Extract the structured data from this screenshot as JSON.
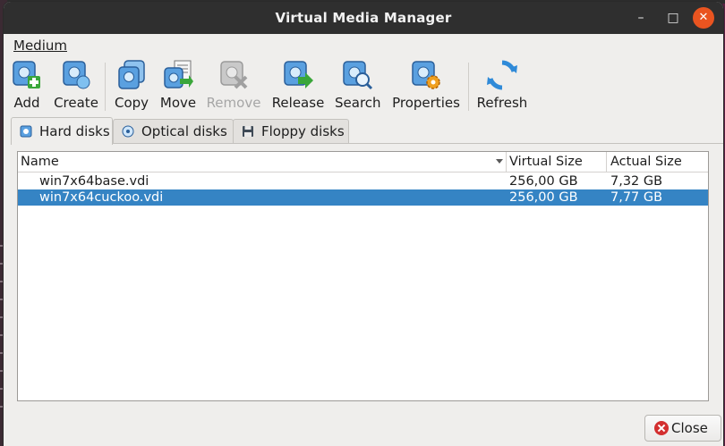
{
  "window": {
    "title": "Virtual Media Manager"
  },
  "menubar": {
    "medium": "Medium"
  },
  "toolbar": [
    {
      "label": "Add",
      "enabled": true,
      "icon": "disk-add-icon"
    },
    {
      "label": "Create",
      "enabled": true,
      "icon": "disk-create-icon"
    },
    {
      "label": "Copy",
      "enabled": true,
      "icon": "disk-copy-icon"
    },
    {
      "label": "Move",
      "enabled": true,
      "icon": "disk-move-icon"
    },
    {
      "label": "Remove",
      "enabled": false,
      "icon": "disk-remove-icon"
    },
    {
      "label": "Release",
      "enabled": true,
      "icon": "disk-release-icon"
    },
    {
      "label": "Search",
      "enabled": true,
      "icon": "disk-search-icon"
    },
    {
      "label": "Properties",
      "enabled": true,
      "icon": "disk-properties-icon"
    },
    {
      "label": "Refresh",
      "enabled": true,
      "icon": "refresh-icon"
    }
  ],
  "tabs": [
    {
      "label": "Hard disks",
      "active": true,
      "icon": "hard-disk-icon"
    },
    {
      "label": "Optical disks",
      "active": false,
      "icon": "optical-disk-icon"
    },
    {
      "label": "Floppy disks",
      "active": false,
      "icon": "floppy-disk-icon"
    }
  ],
  "table": {
    "columns": [
      "Name",
      "Virtual Size",
      "Actual Size"
    ],
    "sort_column": "Name",
    "rows": [
      {
        "name": "win7x64base.vdi",
        "virtual_size": "256,00 GB",
        "actual_size": "7,32 GB",
        "selected": false
      },
      {
        "name": "win7x64cuckoo.vdi",
        "virtual_size": "256,00 GB",
        "actual_size": "7,77 GB",
        "selected": true
      }
    ]
  },
  "footer": {
    "close_label": "Close"
  },
  "colors": {
    "accent_selection": "#3584c4",
    "titlebar": "#2f2f2f",
    "close_window": "#e95420"
  }
}
